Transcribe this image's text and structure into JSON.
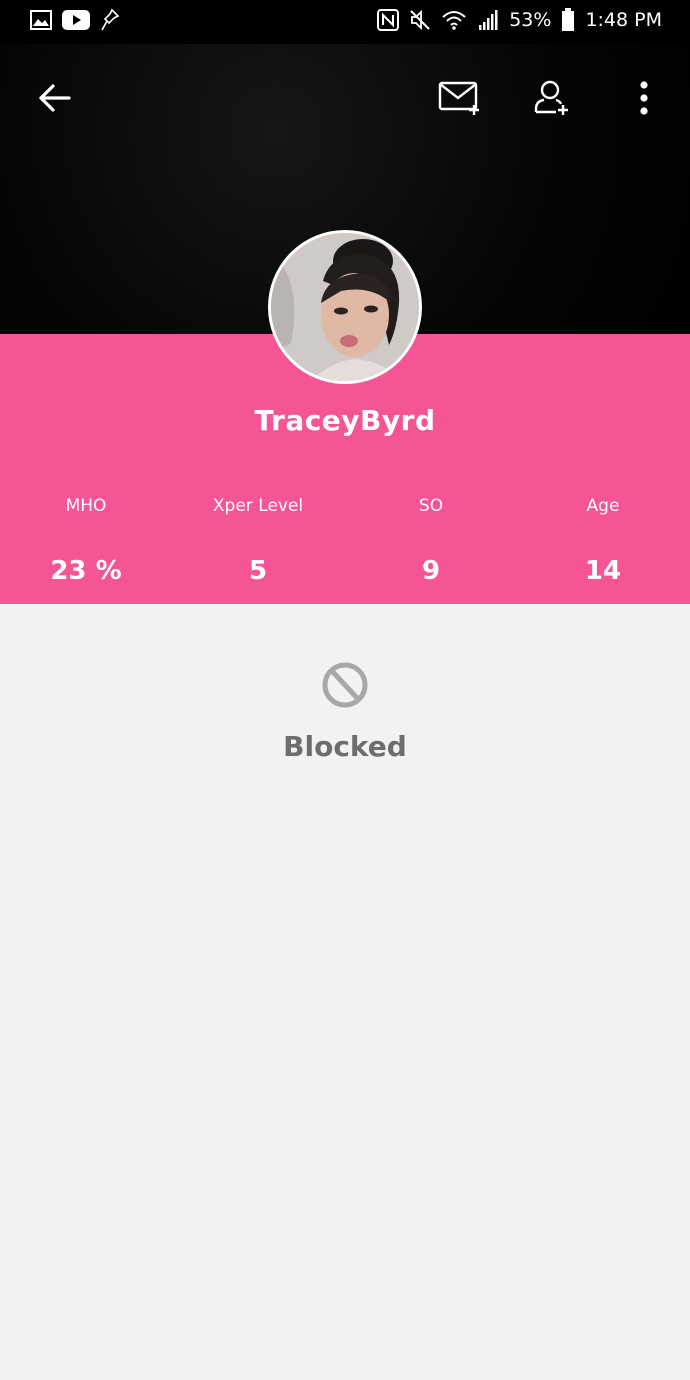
{
  "status_bar": {
    "left_icons": [
      "gallery-icon",
      "youtube-icon",
      "pin-icon"
    ],
    "right_icons": [
      "nfc-icon",
      "mute-icon",
      "wifi-icon",
      "signal-icon",
      "battery-icon"
    ],
    "battery": "53%",
    "time": "1:48 PM"
  },
  "toolbar": {
    "back_icon": "arrow-left-icon",
    "message_icon": "mail-plus-icon",
    "follow_icon": "user-plus-icon",
    "more_icon": "more-vertical-icon"
  },
  "profile": {
    "username": "TraceyByrd",
    "stats": [
      {
        "label": "MHO",
        "value": "23 %"
      },
      {
        "label": "Xper Level",
        "value": "5"
      },
      {
        "label": "SO",
        "value": "9"
      },
      {
        "label": "Age",
        "value": "14"
      }
    ]
  },
  "content": {
    "status_icon": "blocked-icon",
    "status_text": "Blocked"
  },
  "colors": {
    "accent": "#f55594",
    "header_bg": "#000000",
    "page_bg": "#f2f2f2",
    "muted": "#6d6d6d"
  }
}
